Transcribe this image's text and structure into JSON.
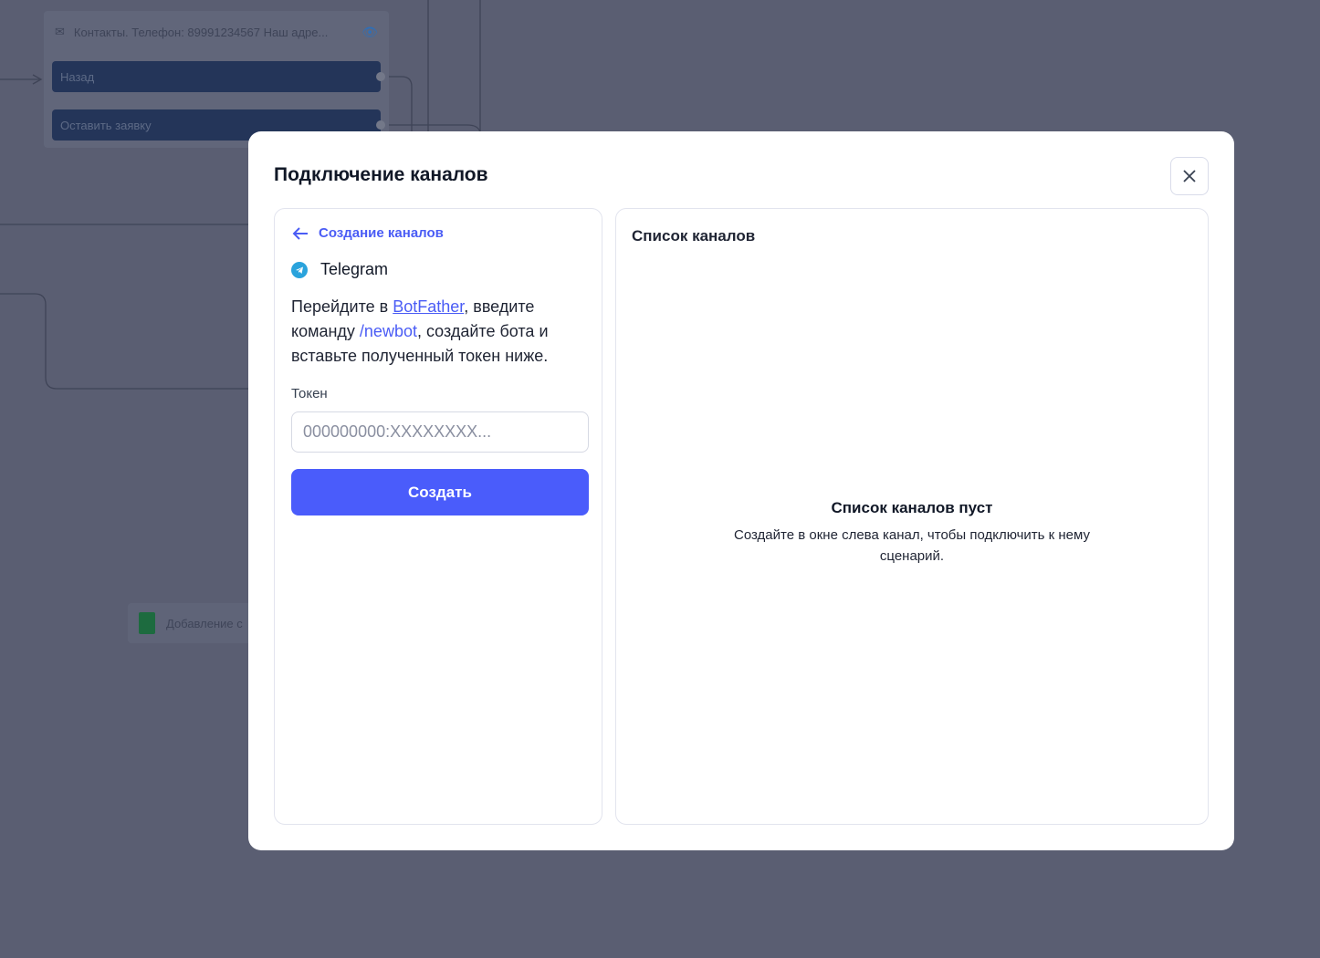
{
  "background": {
    "node": {
      "message": "Контакты. Телефон: 89991234567 Наш адре...",
      "buttons": [
        "Назад",
        "Оставить заявку"
      ]
    },
    "node2": {
      "label": "Добавление с"
    }
  },
  "modal": {
    "title": "Подключение каналов",
    "left": {
      "back_label": "Создание каналов",
      "channel": "Telegram",
      "instruction": {
        "part1": "Перейдите в ",
        "link": "BotFather",
        "part2": ", введите команду ",
        "command": "/newbot",
        "part3": ", создайте бота и вставьте полученный токен ниже."
      },
      "token_label": "Токен",
      "token_placeholder": "000000000:XXXXXXXX...",
      "token_value": "",
      "create_label": "Создать"
    },
    "right": {
      "title": "Список каналов",
      "empty_title": "Список каналов пуст",
      "empty_subtitle": "Создайте в окне слева канал, чтобы подключить к нему сценарий."
    }
  },
  "colors": {
    "accent": "#4a5cfb",
    "telegram": "#2aa3dc",
    "overlay": "#5a5e72"
  }
}
